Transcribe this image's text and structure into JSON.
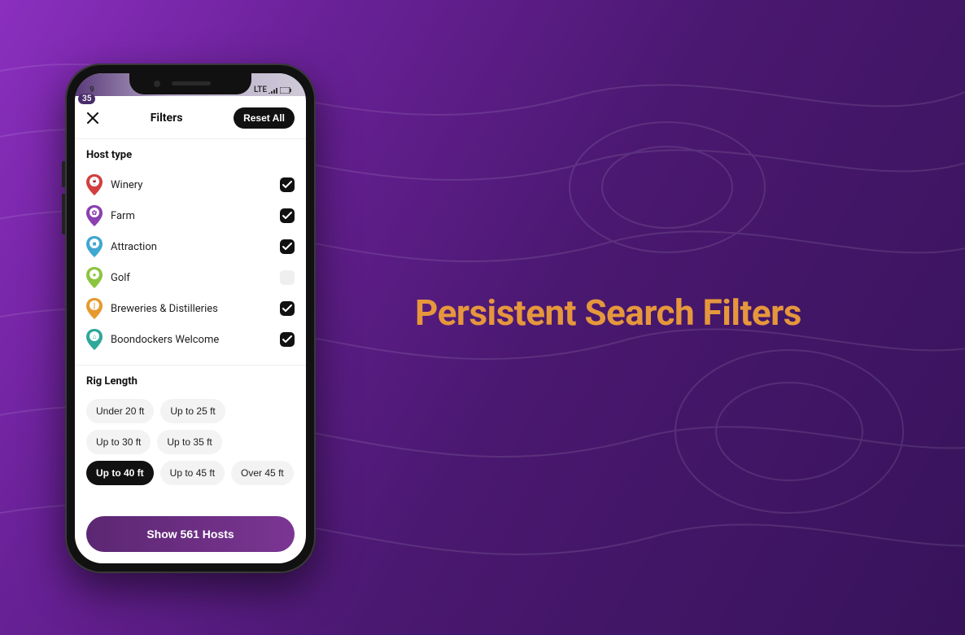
{
  "headline": "Persistent Search Filters",
  "statusbar": {
    "left": "9",
    "network": "LTE",
    "bubble": "35"
  },
  "header": {
    "title": "Filters",
    "reset": "Reset All"
  },
  "sections": {
    "host_type": {
      "title": "Host type",
      "items": [
        {
          "label": "Winery",
          "checked": true,
          "color": "#d23f3f",
          "glyph": "🍷"
        },
        {
          "label": "Farm",
          "checked": true,
          "color": "#8b3fb0",
          "glyph": "✿"
        },
        {
          "label": "Attraction",
          "checked": true,
          "color": "#3fa7d2",
          "glyph": "■"
        },
        {
          "label": "Golf",
          "checked": false,
          "color": "#8bc53f",
          "glyph": "●"
        },
        {
          "label": "Breweries & Distilleries",
          "checked": true,
          "color": "#e69a2e",
          "glyph": "❘"
        },
        {
          "label": "Boondockers Welcome",
          "checked": true,
          "color": "#2ea89a",
          "glyph": "⌂"
        }
      ]
    },
    "rig_length": {
      "title": "Rig Length",
      "options": [
        {
          "label": "Under 20 ft",
          "active": false
        },
        {
          "label": "Up to 25 ft",
          "active": false
        },
        {
          "label": "Up to 30 ft",
          "active": false
        },
        {
          "label": "Up to 35 ft",
          "active": false
        },
        {
          "label": "Up to 40 ft",
          "active": true
        },
        {
          "label": "Up to 45 ft",
          "active": false
        },
        {
          "label": "Over 45 ft",
          "active": false
        }
      ]
    }
  },
  "cta_label": "Show 561 Hosts"
}
